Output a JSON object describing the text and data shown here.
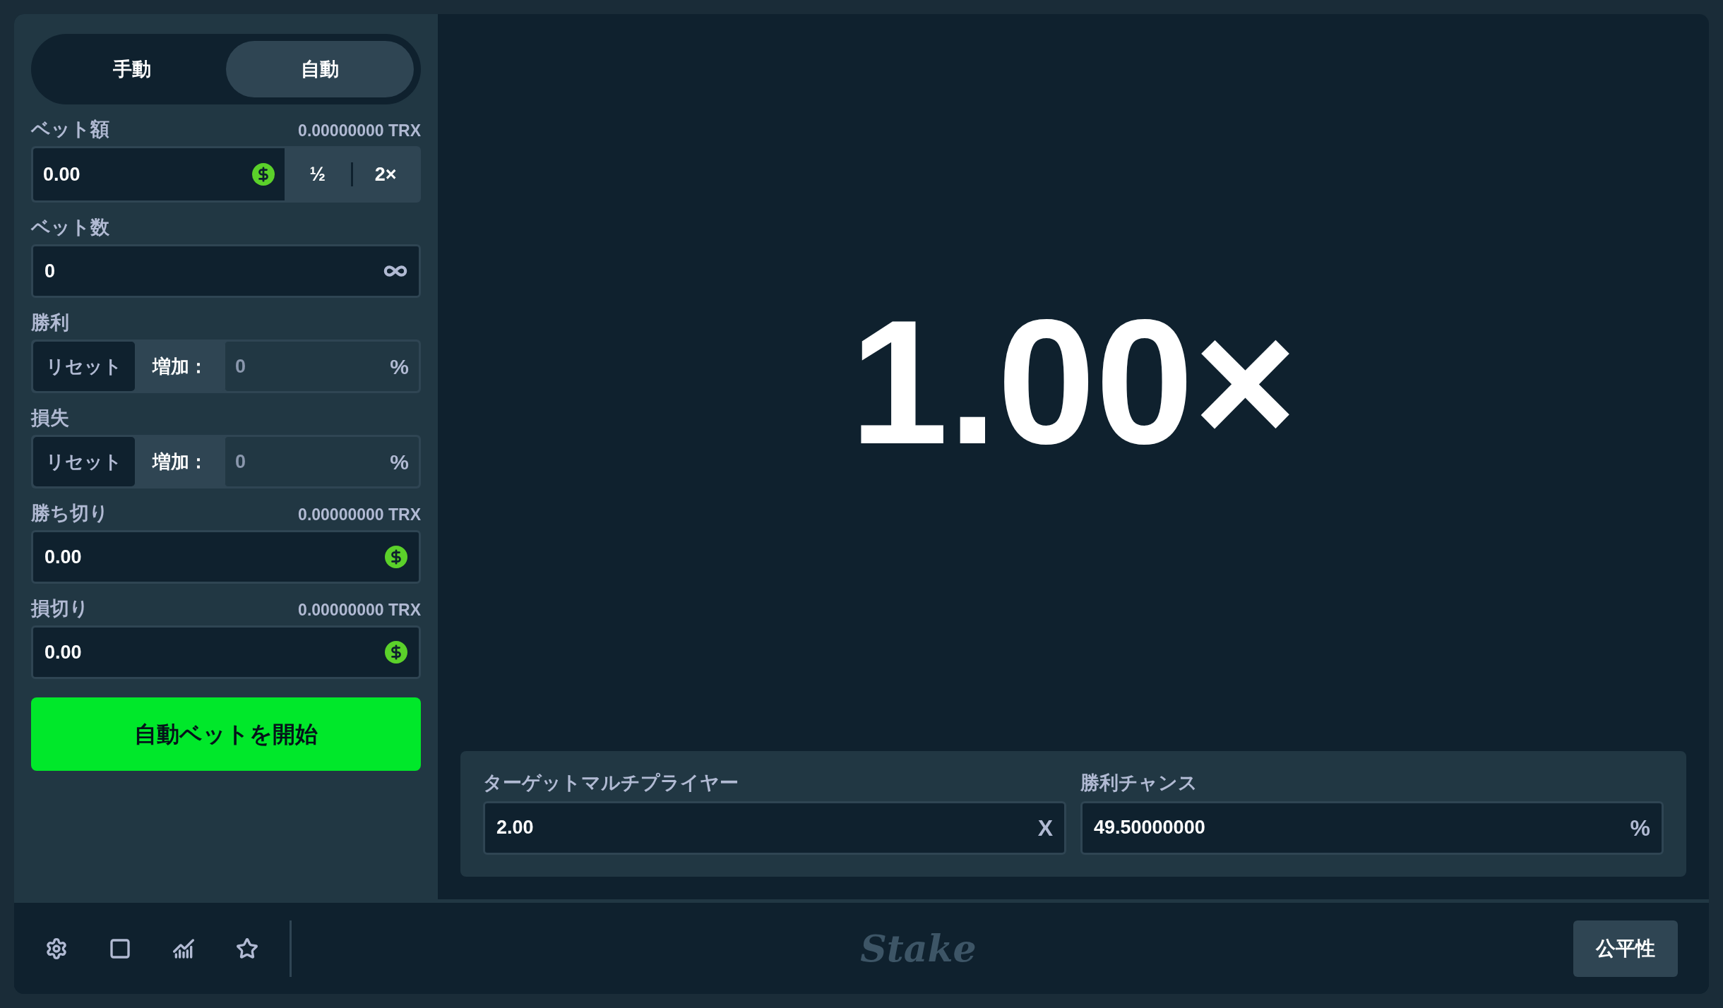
{
  "mode_tabs": [
    {
      "label": "手動",
      "selected": false
    },
    {
      "label": "自動",
      "selected": true
    }
  ],
  "bet_amount": {
    "label": "ベット額",
    "converted": "0.00000000 TRX",
    "value": "0.00",
    "half": "½",
    "double": "2×"
  },
  "bet_count": {
    "label": "ベット数",
    "value": "0"
  },
  "on_win": {
    "label": "勝利",
    "options": [
      {
        "label": "リセット",
        "selected": true
      },
      {
        "label": "増加：",
        "selected": false
      }
    ],
    "value": "0",
    "unit": "%"
  },
  "on_loss": {
    "label": "損失",
    "options": [
      {
        "label": "リセット",
        "selected": true
      },
      {
        "label": "増加：",
        "selected": false
      }
    ],
    "value": "0",
    "unit": "%"
  },
  "stop_on_profit": {
    "label": "勝ち切り",
    "converted": "0.00000000 TRX",
    "value": "0.00"
  },
  "stop_on_loss": {
    "label": "損切り",
    "converted": "0.00000000 TRX",
    "value": "0.00"
  },
  "start_button": "自動ベットを開始",
  "multiplier_display": "1.00×",
  "target_multiplier": {
    "label": "ターゲットマルチプライヤー",
    "value": "2.00",
    "unit": "X"
  },
  "win_chance": {
    "label": "勝利チャンス",
    "value": "49.50000000",
    "unit": "%"
  },
  "footer": {
    "logo": "Stake",
    "fairness_button": "公平性"
  }
}
